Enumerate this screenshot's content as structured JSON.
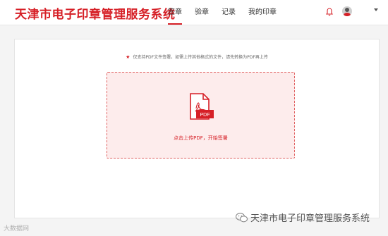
{
  "header": {
    "app_title": "天津市电子印章管理服务系统",
    "nav": [
      "签章",
      "验章",
      "记录",
      "我的印章"
    ],
    "active_nav": 0,
    "icons": {
      "bell": "bell-icon",
      "avatar": "avatar",
      "caret": "chevron-down-icon"
    }
  },
  "main": {
    "notice_star": "★",
    "notice": "仅支持PDF文件签署，如需上传其他格式的文件，请先转换为PDF再上传",
    "upload": {
      "icon": "pdf-file-icon",
      "icon_label": "PDF",
      "text": "点击上传PDF，开始签署"
    }
  },
  "watermarks": {
    "left": "大数据网",
    "right": "天津市电子印章管理服务系统"
  },
  "colors": {
    "accent": "#d61f26",
    "upload_bg": "#fdecec"
  }
}
